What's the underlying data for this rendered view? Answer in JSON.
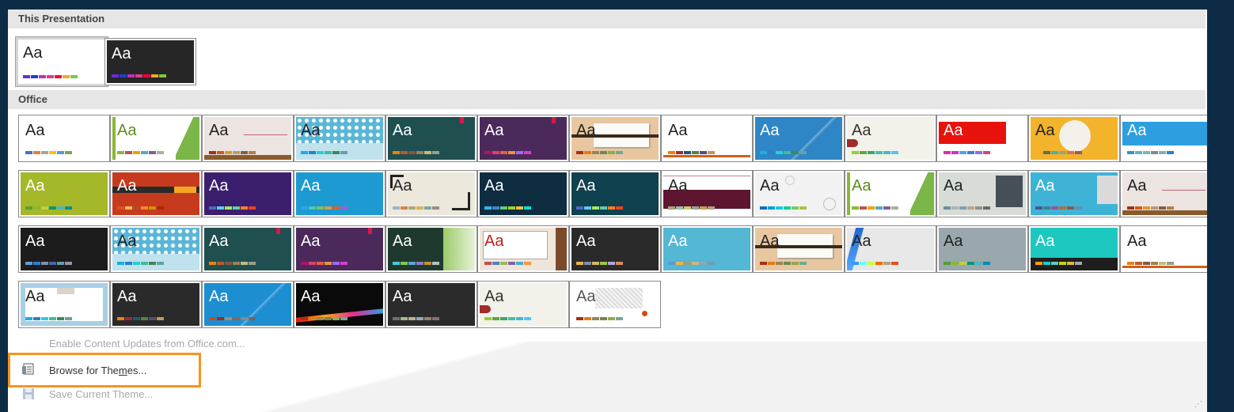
{
  "sections": {
    "this_presentation": "This Presentation",
    "office": "Office"
  },
  "preview_text": "Aa",
  "menu": {
    "enable_updates": "Enable Content Updates from Office.com...",
    "browse_themes": "Browse for Themes...",
    "save_theme": "Save Current Theme..."
  },
  "this_presentation_themes": [
    {
      "bg": "#ffffff",
      "fg": "#222222",
      "sw": [
        "#6a2bd9",
        "#1f3ecc",
        "#c42fb5",
        "#e23a8a",
        "#f03",
        "#f5a623",
        "#7ac943"
      ]
    },
    {
      "bg": "#262626",
      "fg": "#ffffff",
      "sw": [
        "#6a2bd9",
        "#1f3ecc",
        "#c42fb5",
        "#e23a8a",
        "#f03",
        "#f5a623",
        "#7ac943"
      ]
    }
  ],
  "office_themes": [
    {
      "bg": "#ffffff",
      "fg": "#222222",
      "sw": [
        "#4472c4",
        "#ed7d31",
        "#a5a5a5",
        "#ffc000",
        "#5b9bd5",
        "#70ad47"
      ]
    },
    {
      "bg": "#ffffff",
      "fg": "#5a8e22",
      "sw": [
        "#8ab833",
        "#c0504d",
        "#f59e00",
        "#4bacc6",
        "#7f5f9e",
        "#a5b592"
      ],
      "deco": "green-slant"
    },
    {
      "bg": "#ece4e0",
      "fg": "#222222",
      "sw": [
        "#a5300f",
        "#d55816",
        "#e19825",
        "#b19c7d",
        "#7f5f52",
        "#b27d49"
      ],
      "deco": "wood-line"
    },
    {
      "bg": "#bfe2ee",
      "fg": "#222222",
      "sw": [
        "#1cade4",
        "#2683c6",
        "#27ced7",
        "#42ba97",
        "#3e8853",
        "#62a39f"
      ],
      "deco": "pattern"
    },
    {
      "bg": "#1f4f4f",
      "fg": "#ffffff",
      "sw": [
        "#e48312",
        "#bd582c",
        "#865640",
        "#9b8357",
        "#c2bc80",
        "#94a088"
      ],
      "deco": "red-tab"
    },
    {
      "bg": "#4b2a5b",
      "fg": "#ffffff",
      "sw": [
        "#b31166",
        "#e33d6f",
        "#e45f3c",
        "#e9943a",
        "#9b6bf2",
        "#d53dd0"
      ],
      "deco": "red-tab"
    },
    {
      "bg": "#e8c7a0",
      "fg": "#222222",
      "sw": [
        "#a53010",
        "#de7e18",
        "#9f8351",
        "#728653",
        "#92aa4c",
        "#6aac91"
      ],
      "deco": "card"
    },
    {
      "bg": "#ffffff",
      "fg": "#222222",
      "sw": [
        "#f07f09",
        "#9f2936",
        "#1b587c",
        "#4e8542",
        "#604878",
        "#c19859"
      ],
      "deco": "orange-line"
    },
    {
      "bg": "#2f86c6",
      "fg": "#ffffff",
      "sw": [
        "#1cade4",
        "#2683c6",
        "#27ced7",
        "#42ba97",
        "#3e8853",
        "#62a39f"
      ],
      "deco": "light-slash"
    },
    {
      "bg": "#f2f2ea",
      "fg": "#333333",
      "sw": [
        "#99cb38",
        "#63a537",
        "#37a76f",
        "#44c1a3",
        "#4eb3cf",
        "#51c3f9"
      ],
      "deco": "leaf"
    },
    {
      "bg": "#ffffff",
      "fg": "#ffffff",
      "sw": [
        "#e32d91",
        "#c830cc",
        "#4ea6dc",
        "#4775e7",
        "#8971e1",
        "#d54773"
      ],
      "deco": "red-block"
    },
    {
      "bg": "#f3b32a",
      "fg": "#222222",
      "sw": [
        "#f8b323",
        "#656a59",
        "#46b2b5",
        "#8caa7e",
        "#d36f68",
        "#826276"
      ],
      "deco": "circle"
    },
    {
      "bg": "#ffffff",
      "fg": "#ffffff",
      "sw": [
        "#3494ba",
        "#58b6c0",
        "#75bda7",
        "#7a8c8e",
        "#84acb6",
        "#2683c6"
      ],
      "deco": "blue-band"
    },
    {
      "bg": "#a4b82a",
      "fg": "#ffffff",
      "sw": [
        "#549e39",
        "#8ab833",
        "#c0cf3a",
        "#029676",
        "#4ab5c4",
        "#0989b1"
      ]
    },
    {
      "bg": "#c63b1e",
      "fg": "#ffffff",
      "sw": [
        "#e84c22",
        "#ffbd47",
        "#b64926",
        "#ff8427",
        "#cc9900",
        "#b22600"
      ],
      "deco": "orange-bar"
    },
    {
      "bg": "#3b1f6e",
      "fg": "#ffffff",
      "sw": [
        "#4e67c8",
        "#5eccf3",
        "#a7ea52",
        "#5dceaf",
        "#ff8021",
        "#f14124"
      ]
    },
    {
      "bg": "#1c9ad1",
      "fg": "#ffffff",
      "sw": [
        "#2fa3ee",
        "#4bcaad",
        "#86c157",
        "#d99c3f",
        "#ce6633",
        "#a35dd1"
      ]
    },
    {
      "bg": "#ede8dc",
      "fg": "#222222",
      "sw": [
        "#94b6d2",
        "#dd8047",
        "#a5ab81",
        "#d8b25c",
        "#7ba79d",
        "#968c8c"
      ],
      "deco": "frame"
    },
    {
      "bg": "#0f2d40",
      "fg": "#ffffff",
      "sw": [
        "#31b6fd",
        "#4584d3",
        "#5bd078",
        "#a5d028",
        "#f5c040",
        "#05e0db"
      ]
    },
    {
      "bg": "#10414f",
      "fg": "#ffffff",
      "sw": [
        "#4e67c8",
        "#5eccf3",
        "#a7ea52",
        "#5dceaf",
        "#ff8021",
        "#f14124"
      ]
    },
    {
      "bg": "#ffffff",
      "fg": "#222222",
      "sw": [
        "#a9a57c",
        "#9cbebd",
        "#d2cb6c",
        "#95a39d",
        "#c89f5d",
        "#b1a089"
      ],
      "deco": "maroon-block"
    },
    {
      "bg": "#f2f2f2",
      "fg": "#222222",
      "sw": [
        "#0f6fc6",
        "#009dd9",
        "#0bd0d9",
        "#10cf9b",
        "#7cca62",
        "#a5c249"
      ],
      "deco": "bubbles"
    },
    {
      "bg": "#ffffff",
      "fg": "#5a8e22",
      "sw": [
        "#8ab833",
        "#c0504d",
        "#f59e00",
        "#4bacc6",
        "#7f5f9e",
        "#a5b592"
      ],
      "deco": "green-slant"
    },
    {
      "bg": "#d7dcd6",
      "fg": "#222222",
      "sw": [
        "#6a8fa0",
        "#aab5b8",
        "#7e9cb1",
        "#c6a18e",
        "#91918c",
        "#6b6b6b"
      ],
      "deco": "dark-card"
    },
    {
      "bg": "#3fb3d6",
      "fg": "#ffffff",
      "sw": [
        "#53548a",
        "#438086",
        "#a04da3",
        "#c4652d",
        "#8b5d3d",
        "#5c92b5"
      ],
      "deco": "grey-side"
    },
    {
      "bg": "#ece4e0",
      "fg": "#222222",
      "sw": [
        "#a5300f",
        "#d55816",
        "#e19825",
        "#b19c7d",
        "#7f5f52",
        "#b27d49"
      ],
      "deco": "wood-line"
    },
    {
      "bg": "#1c1c1c",
      "fg": "#ffffff",
      "sw": [
        "#629dd1",
        "#297fd5",
        "#7f8fa9",
        "#4a66ac",
        "#5aa2ae",
        "#9d90a0"
      ]
    },
    {
      "bg": "#bfe2ee",
      "fg": "#222222",
      "sw": [
        "#1cade4",
        "#2683c6",
        "#27ced7",
        "#42ba97",
        "#3e8853",
        "#62a39f"
      ],
      "deco": "pattern"
    },
    {
      "bg": "#1f4f4f",
      "fg": "#ffffff",
      "sw": [
        "#e48312",
        "#bd582c",
        "#865640",
        "#9b8357",
        "#c2bc80",
        "#94a088"
      ],
      "deco": "red-tab"
    },
    {
      "bg": "#4b2a5b",
      "fg": "#ffffff",
      "sw": [
        "#b31166",
        "#e33d6f",
        "#e45f3c",
        "#e9943a",
        "#9b6bf2",
        "#d53dd0"
      ],
      "deco": "red-tab"
    },
    {
      "bg": "#1e3a2e",
      "fg": "#ffffff",
      "sw": [
        "#4cc9d8",
        "#88c44f",
        "#5ba7d6",
        "#8e7cc3",
        "#c58f3c",
        "#b5c0c3"
      ],
      "deco": "green-side"
    },
    {
      "bg": "#efe5da",
      "fg": "#c0201a",
      "sw": [
        "#c0504d",
        "#4f81bd",
        "#9bbb59",
        "#8064a2",
        "#4bacc6",
        "#f79646"
      ],
      "deco": "red-card"
    },
    {
      "bg": "#2a2a2a",
      "fg": "#ffffff",
      "sw": [
        "#e8b54d",
        "#7f8fa9",
        "#d1b96c",
        "#9ec544",
        "#b4a6e0",
        "#d98c5f"
      ]
    },
    {
      "bg": "#54b7d3",
      "fg": "#ffffff",
      "sw": [
        "#5b9bd5",
        "#e8b54d",
        "#94a088",
        "#c8b58a",
        "#84acb6",
        "#6e9eb8"
      ]
    },
    {
      "bg": "#e8c7a0",
      "fg": "#222222",
      "sw": [
        "#a53010",
        "#de7e18",
        "#9f8351",
        "#728653",
        "#92aa4c",
        "#6aac91"
      ],
      "deco": "card"
    },
    {
      "bg": "#e8e8e8",
      "fg": "#222222",
      "sw": [
        "#3399ff",
        "#69ffff",
        "#ccff33",
        "#ff6600",
        "#a9a57c",
        "#e84c22"
      ],
      "deco": "blue-swoosh"
    },
    {
      "bg": "#9aa7ad",
      "fg": "#222222",
      "sw": [
        "#549e39",
        "#8ab833",
        "#c0cf3a",
        "#029676",
        "#4ab5c4",
        "#0989b1"
      ]
    },
    {
      "bg": "#1dc8c0",
      "fg": "#ffffff",
      "sw": [
        "#fe9e00",
        "#0bd0d9",
        "#5ecfb1",
        "#c4d600",
        "#e0b73e",
        "#a6a6a6"
      ],
      "deco": "dark-band"
    },
    {
      "bg": "#ffffff",
      "fg": "#222222",
      "sw": [
        "#e48312",
        "#bd582c",
        "#865640",
        "#9b8357",
        "#c2bc80",
        "#94a088"
      ],
      "deco": "orange-line"
    },
    {
      "bg": "#ffffff",
      "fg": "#222222",
      "sw": [
        "#1cade4",
        "#2683c6",
        "#27ced7",
        "#42ba97",
        "#3e8853",
        "#62a39f"
      ],
      "deco": "dot-frame"
    },
    {
      "bg": "#2a2a2a",
      "fg": "#ffffff",
      "sw": [
        "#f07f09",
        "#9f2936",
        "#1b587c",
        "#4e8542",
        "#604878",
        "#c19859"
      ]
    },
    {
      "bg": "#1c8ed1",
      "fg": "#ffffff",
      "sw": [
        "#d34817",
        "#9b2d1f",
        "#a28e6a",
        "#956251",
        "#918485",
        "#855d5d"
      ],
      "deco": "light-slash"
    },
    {
      "bg": "#0a0a0a",
      "fg": "#ffffff",
      "sw": [
        "#a53010",
        "#de7e18",
        "#9f8351",
        "#728653",
        "#92aa4c",
        "#6aac91"
      ],
      "deco": "colorful-swoosh"
    },
    {
      "bg": "#2b2b2b",
      "fg": "#ffffff",
      "sw": [
        "#6f6f74",
        "#a7b789",
        "#beae98",
        "#92a9b9",
        "#9c8265",
        "#8d6974"
      ]
    },
    {
      "bg": "#f2f2ea",
      "fg": "#333333",
      "sw": [
        "#99cb38",
        "#63a537",
        "#37a76f",
        "#44c1a3",
        "#4eb3cf",
        "#51c3f9"
      ],
      "deco": "leaf"
    },
    {
      "bg": "#ffffff",
      "fg": "#555555",
      "sw": [
        "#a53010",
        "#de7e18",
        "#9f8351",
        "#728653",
        "#92aa4c",
        "#6aac91"
      ],
      "deco": "grey-noise"
    }
  ]
}
